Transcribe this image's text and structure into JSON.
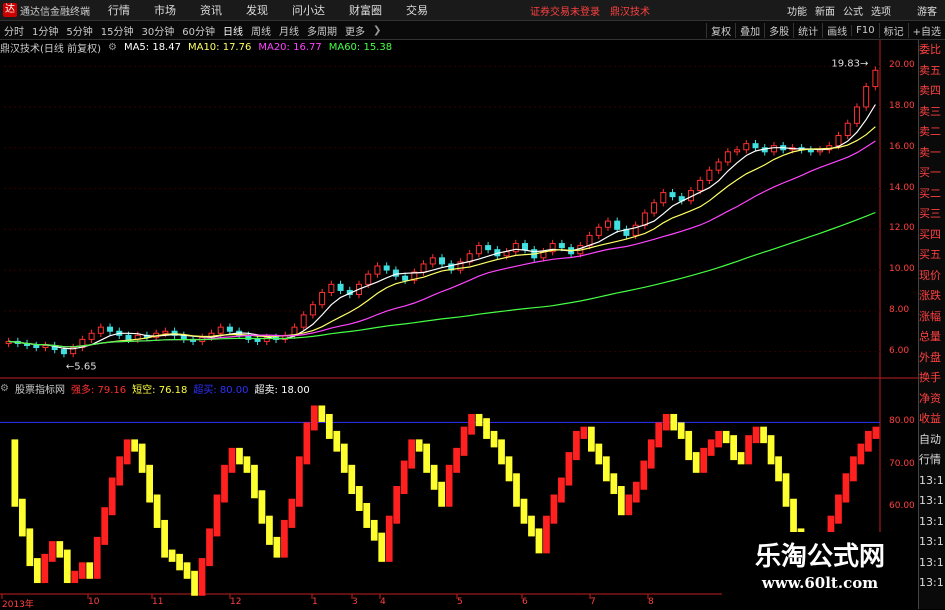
{
  "app": {
    "logo": "达",
    "title": "通达信金融终端"
  },
  "menu": [
    "行情",
    "市场",
    "资讯",
    "发现",
    "问小达",
    "财富圈",
    "交易"
  ],
  "alert": "证券交易未登录",
  "stock_name_top": "鼎汉技术",
  "right_menu": [
    "功能",
    "新面",
    "公式",
    "选项"
  ],
  "guest_label": "游客",
  "periods": [
    "分时",
    "1分钟",
    "5分钟",
    "15分钟",
    "30分钟",
    "60分钟",
    "日线",
    "周线",
    "月线",
    "多周期",
    "更多"
  ],
  "period_more_icon": "chevron-right-icon",
  "toolbar": [
    "复权",
    "叠加",
    "多股",
    "统计",
    "画线",
    "F10",
    "标记",
    "+自选"
  ],
  "price_panel": {
    "title": "鼎汉技术(日线 前复权)",
    "ma": [
      {
        "label": "MA5: 18.47",
        "color": "#ffffff"
      },
      {
        "label": "MA10: 17.76",
        "color": "#ffff66"
      },
      {
        "label": "MA20: 16.77",
        "color": "#ff44ff"
      },
      {
        "label": "MA60: 15.38",
        "color": "#44ff44"
      }
    ],
    "y_ticks": [
      "20.00",
      "18.00",
      "16.00",
      "14.00",
      "12.00",
      "10.00",
      "8.00",
      "6.00"
    ],
    "low_label": "5.65",
    "high_label": "19.83"
  },
  "indicator_panel": {
    "title": "股票指标网",
    "items": [
      {
        "label": "强多: 79.16",
        "color": "#ff3030"
      },
      {
        "label": "短空: 76.18",
        "color": "#ffff40"
      },
      {
        "label": "超买: 80.00",
        "color": "#3030ff"
      },
      {
        "label": "超卖: 18.00",
        "color": "#ffffff"
      }
    ],
    "y_ticks": [
      "80.00",
      "70.00",
      "60.00",
      "50.00"
    ],
    "overbought": 80,
    "oversold": 18
  },
  "x_labels": [
    "2013年",
    "10",
    "11",
    "12",
    "1",
    "3",
    "4",
    "5",
    "6",
    "7",
    "8"
  ],
  "side_panel": [
    "委比",
    "卖五",
    "卖四",
    "卖三",
    "卖二",
    "卖一",
    "买一",
    "买二",
    "买三",
    "买四",
    "买五",
    "现价",
    "涨跌",
    "涨幅",
    "总量",
    "外盘",
    "换手",
    "净资",
    "收益",
    "自动",
    "行情",
    "13:1",
    "13:1",
    "13:1",
    "13:1",
    "13:1",
    "13:1"
  ],
  "watermark": {
    "main": "乐淘公式网",
    "url": "www.60lt.com"
  },
  "chart_data": [
    {
      "type": "candlestick",
      "title": "鼎汉技术(日线 前复权)",
      "ylim": [
        5,
        20.5
      ],
      "y_ticks": [
        6,
        8,
        10,
        12,
        14,
        16,
        18,
        20
      ],
      "close": [
        6.5,
        6.4,
        6.3,
        6.2,
        6.3,
        6.1,
        5.9,
        6.2,
        6.6,
        6.9,
        7.2,
        7.0,
        6.8,
        6.6,
        6.8,
        6.7,
        6.9,
        7.0,
        6.8,
        6.6,
        6.5,
        6.7,
        6.9,
        7.2,
        7.0,
        6.8,
        6.6,
        6.5,
        6.7,
        6.6,
        6.8,
        7.2,
        7.8,
        8.3,
        8.9,
        9.3,
        9.0,
        8.8,
        9.3,
        9.8,
        10.2,
        10.0,
        9.7,
        9.5,
        9.9,
        10.3,
        10.6,
        10.3,
        10.0,
        10.4,
        10.8,
        11.2,
        11.0,
        10.7,
        10.9,
        11.3,
        11.0,
        10.6,
        10.9,
        11.3,
        11.1,
        10.8,
        11.2,
        11.7,
        12.1,
        12.4,
        12.0,
        11.7,
        12.2,
        12.8,
        13.3,
        13.8,
        13.6,
        13.4,
        13.9,
        14.4,
        14.9,
        15.3,
        15.8,
        15.9,
        16.2,
        16.0,
        15.8,
        16.1,
        15.9,
        16.0,
        15.9,
        15.8,
        15.9,
        16.1,
        16.6,
        17.2,
        18.0,
        19.0,
        19.8
      ],
      "ma": [
        {
          "name": "MA5",
          "color": "#ffffff",
          "window": 5
        },
        {
          "name": "MA10",
          "color": "#ffff66",
          "window": 10
        },
        {
          "name": "MA20",
          "color": "#ff44ff",
          "window": 20
        },
        {
          "name": "MA60",
          "color": "#44ff44",
          "window": 60
        }
      ]
    },
    {
      "type": "bar",
      "title": "股票指标网",
      "ylim": [
        40,
        86
      ],
      "y_ticks": [
        50,
        60,
        70,
        80
      ],
      "values": [
        76,
        62,
        55,
        48,
        44,
        49,
        52,
        50,
        44,
        45,
        47,
        45,
        53,
        60,
        67,
        72,
        76,
        75,
        70,
        63,
        57,
        50,
        49,
        47,
        45,
        41,
        48,
        55,
        63,
        70,
        74,
        72,
        70,
        64,
        58,
        53,
        50,
        57,
        62,
        72,
        80,
        84,
        82,
        78,
        75,
        70,
        65,
        61,
        57,
        54,
        49,
        58,
        65,
        71,
        76,
        75,
        70,
        66,
        62,
        70,
        74,
        79,
        82,
        81,
        78,
        76,
        72,
        68,
        62,
        58,
        55,
        51,
        58,
        63,
        67,
        73,
        78,
        79,
        75,
        72,
        68,
        65,
        60,
        63,
        66,
        71,
        76,
        80,
        82,
        80,
        78,
        73,
        70,
        74,
        76,
        78,
        77,
        73,
        72,
        77,
        79,
        77,
        72,
        68,
        62,
        55,
        50,
        52,
        51,
        54,
        58,
        63,
        68,
        72,
        75,
        78,
        79
      ]
    }
  ]
}
